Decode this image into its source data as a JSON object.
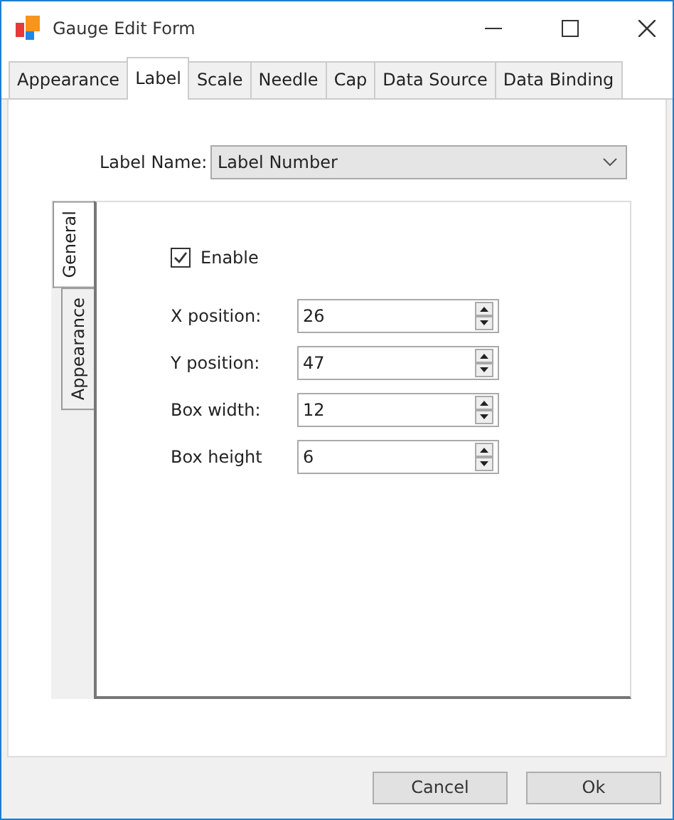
{
  "window": {
    "title": "Gauge Edit Form"
  },
  "tabs": [
    {
      "label": "Appearance",
      "selected": false
    },
    {
      "label": "Label",
      "selected": true
    },
    {
      "label": "Scale",
      "selected": false
    },
    {
      "label": "Needle",
      "selected": false
    },
    {
      "label": "Cap",
      "selected": false
    },
    {
      "label": "Data Source",
      "selected": false
    },
    {
      "label": "Data Binding",
      "selected": false
    }
  ],
  "label_name": {
    "label": "Label Name:",
    "value": "Label Number"
  },
  "side_tabs": [
    {
      "label": "General",
      "selected": true
    },
    {
      "label": "Appearance",
      "selected": false
    }
  ],
  "enable": {
    "label": "Enable",
    "checked": true
  },
  "fields": [
    {
      "label": "X position:",
      "value": "26"
    },
    {
      "label": "Y position:",
      "value": "47"
    },
    {
      "label": "Box width:",
      "value": "12"
    },
    {
      "label": "Box height",
      "value": "6"
    }
  ],
  "buttons": [
    "Cancel",
    "Ok"
  ]
}
